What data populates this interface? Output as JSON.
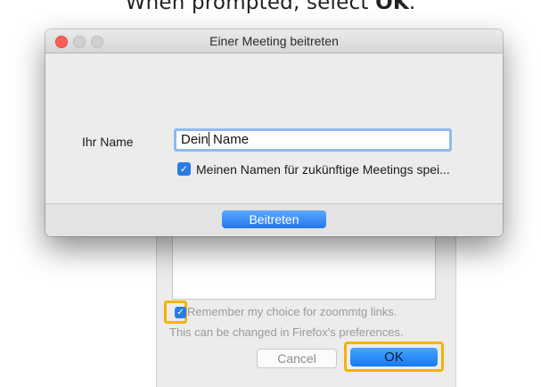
{
  "caption": {
    "prefix": "When prompted, select ",
    "emphasis": "OK",
    "suffix": "."
  },
  "background_dialog": {
    "remember_label": "Remember my choice for zoommtg links.",
    "note": "This can be changed in Firefox's preferences.",
    "cancel_label": "Cancel",
    "ok_label": "OK",
    "remember_checked": true
  },
  "window": {
    "title": "Einer Meeting beitreten",
    "name_label": "Ihr Name",
    "name_value_before_caret": "Dein",
    "name_value_after_caret": " Name",
    "remember_label": "Meinen Namen für zukünftige Meetings spei...",
    "remember_checked": true,
    "join_label": "Beitreten"
  },
  "colors": {
    "accent": "#2a7be6",
    "highlight": "#f5b301",
    "close_button": "#fc5f57"
  }
}
